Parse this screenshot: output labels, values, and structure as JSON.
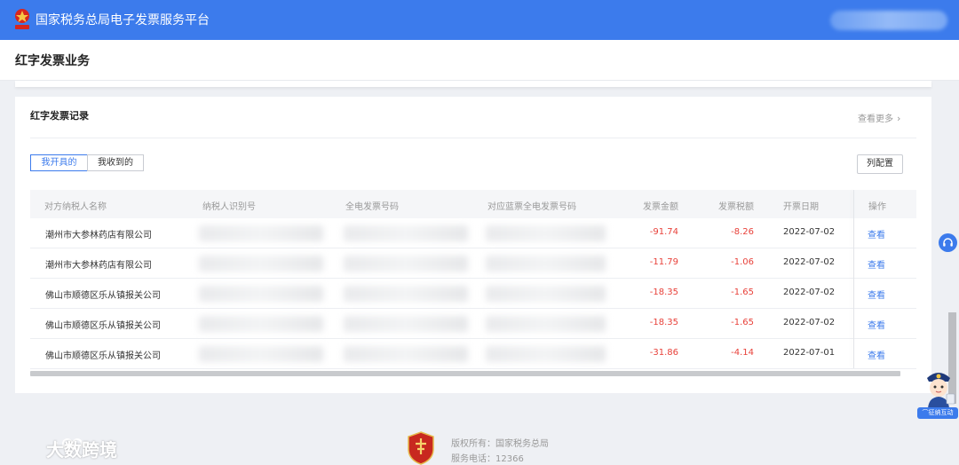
{
  "header": {
    "app_title": "国家税务总局电子发票服务平台",
    "brand_color": "#3c7bec"
  },
  "page": {
    "title": "红字发票业务"
  },
  "card": {
    "title": "红字发票记录",
    "more_link": "查看更多",
    "tabs": [
      {
        "label": "我开具的",
        "active": true
      },
      {
        "label": "我收到的",
        "active": false
      }
    ],
    "column_config_label": "列配置"
  },
  "table": {
    "columns": [
      "对方纳税人名称",
      "纳税人识别号",
      "全电发票号码",
      "对应蓝票全电发票号码",
      "发票金额",
      "发票税额",
      "开票日期",
      "操作"
    ],
    "rows": [
      {
        "name": "潮州市大参林药店有限公司",
        "amount": "-91.74",
        "tax": "-8.26",
        "date": "2022-07-02",
        "action": "查看"
      },
      {
        "name": "潮州市大参林药店有限公司",
        "amount": "-11.79",
        "tax": "-1.06",
        "date": "2022-07-02",
        "action": "查看"
      },
      {
        "name": "佛山市顺德区乐从镇报关公司",
        "amount": "-18.35",
        "tax": "-1.65",
        "date": "2022-07-02",
        "action": "查看"
      },
      {
        "name": "佛山市顺德区乐从镇报关公司",
        "amount": "-18.35",
        "tax": "-1.65",
        "date": "2022-07-02",
        "action": "查看"
      },
      {
        "name": "佛山市顺德区乐从镇报关公司",
        "amount": "-31.86",
        "tax": "-4.14",
        "date": "2022-07-01",
        "action": "查看"
      }
    ],
    "negative_color": "#e8413a",
    "link_color": "#3c7bec"
  },
  "widgets": {
    "mascot_tag": "征纳互动"
  },
  "footer": {
    "watermark": "大数跨境",
    "copyright": "版权所有：国家税务总局",
    "service_phone": "服务电话：12366"
  }
}
